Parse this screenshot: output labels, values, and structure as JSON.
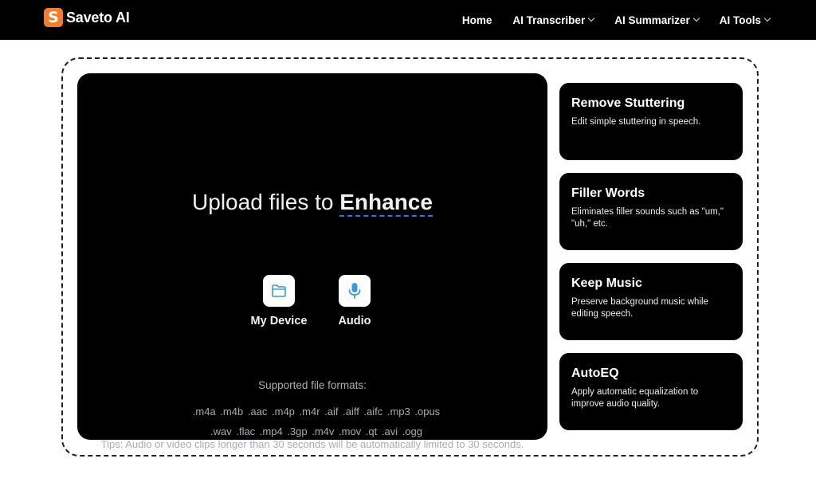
{
  "header": {
    "logo_mark": "S",
    "logo_text": "Saveto AI",
    "nav": [
      {
        "label": "Home",
        "has_dropdown": false
      },
      {
        "label": "AI Transcriber",
        "has_dropdown": true
      },
      {
        "label": "AI Summarizer",
        "has_dropdown": true
      },
      {
        "label": "AI Tools",
        "has_dropdown": true
      }
    ]
  },
  "upload": {
    "title_prefix": "Upload files to ",
    "title_highlight": "Enhance",
    "sources": [
      {
        "label": "My Device",
        "icon": "folder-icon"
      },
      {
        "label": "Audio",
        "icon": "microphone-icon"
      }
    ],
    "formats_title": "Supported file formats:",
    "formats": ".m4a .m4b .aac .m4p .m4r .aif .aiff .aifc .mp3 .opus .wav .flac .mp4 .3gp .m4v .mov .qt .avi .ogg",
    "tips": "Tips: Audio or video clips longer than 30 seconds will be automatically limited to 30 seconds."
  },
  "features": [
    {
      "title": "Remove Stuttering",
      "desc": "Edit simple stuttering in speech."
    },
    {
      "title": "Filler Words",
      "desc": "Eliminates filler sounds such as \"um,\" \"uh,\" etc."
    },
    {
      "title": "Keep Music",
      "desc": "Preserve background music while editing speech."
    },
    {
      "title": "AutoEQ",
      "desc": "Apply automatic equalization to improve audio quality."
    }
  ],
  "colors": {
    "brand": "#f47c2a",
    "highlight_underline": "#3b6ef5",
    "icon_blue": "#3a9ad9",
    "panel": "#000000"
  }
}
